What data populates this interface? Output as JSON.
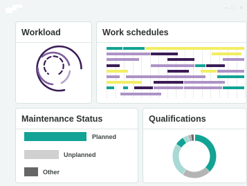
{
  "window": {
    "controls": {
      "minimize": "—",
      "maximize": "□",
      "close": "×"
    }
  },
  "workload": {
    "title": "Workload"
  },
  "schedules": {
    "title": "Work schedules"
  },
  "maintenance": {
    "title": "Maintenance Status",
    "items": [
      {
        "label": "Planned",
        "color": "#12a394"
      },
      {
        "label": "Unplanned",
        "color": "#d0d0d0"
      },
      {
        "label": "Other",
        "color": "#666666"
      }
    ]
  },
  "qualifications": {
    "title": "Qualifications"
  },
  "colors": {
    "teal": "#12a394",
    "purple": "#ad93c6",
    "dark_purple": "#3b1c56",
    "yellow": "#f2ee62",
    "light_teal": "#a9d9d4",
    "grey": "#b4b4b4",
    "dark_grey": "#6a6a6a"
  }
}
